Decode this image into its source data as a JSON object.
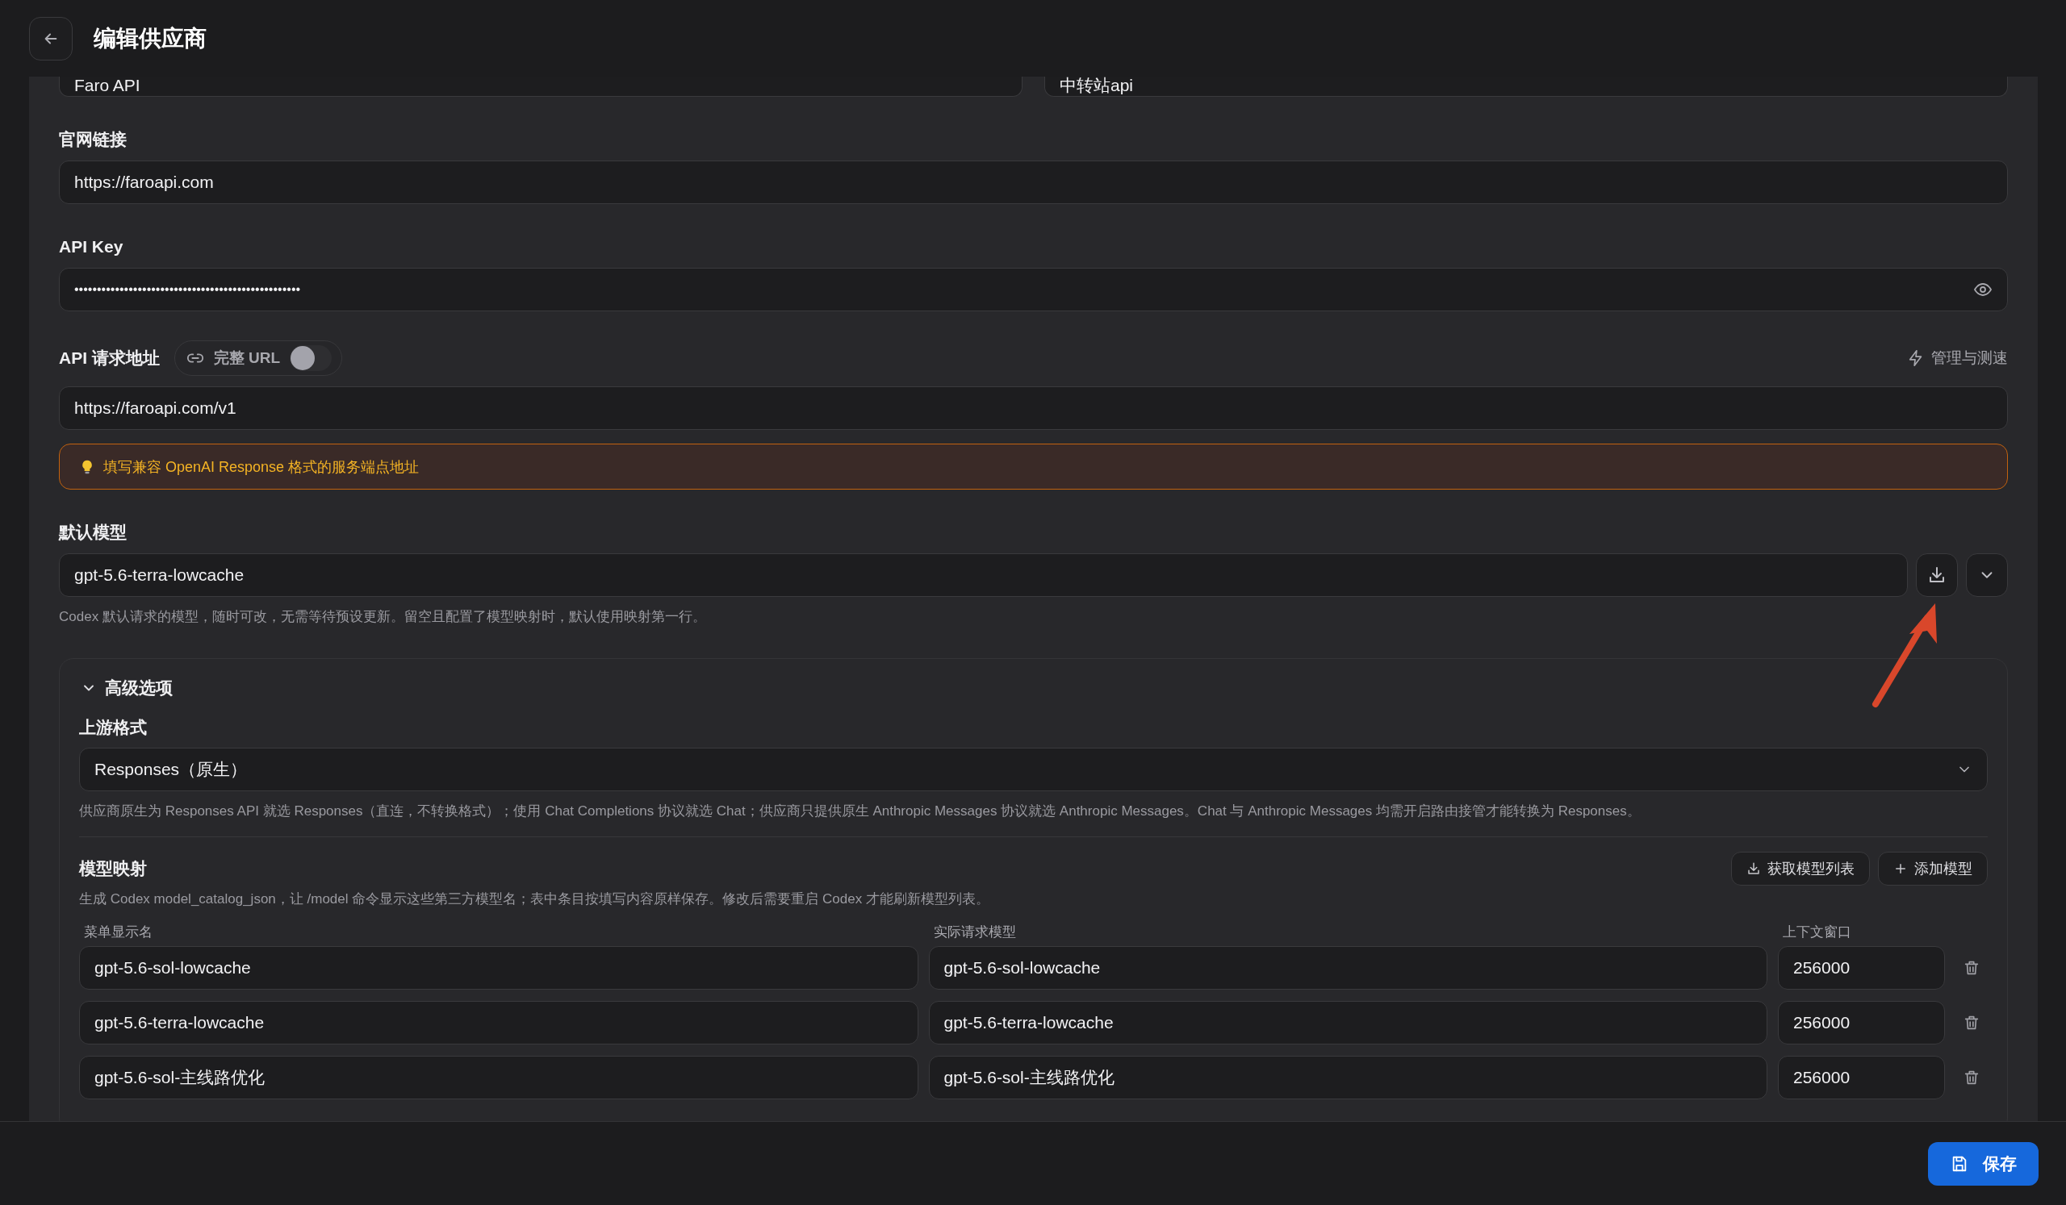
{
  "header": {
    "title": "编辑供应商"
  },
  "basic_fields": [
    {
      "value": "Faro API"
    },
    {
      "value": "中转站api"
    }
  ],
  "website": {
    "label": "官网链接",
    "value": "https://faroapi.com"
  },
  "api_key": {
    "label": "API Key",
    "value": "••••••••••••••••••••••••••••••••••••••••••••••••••"
  },
  "endpoint": {
    "label": "API 请求地址",
    "full_url_toggle": {
      "label": "完整 URL",
      "on": false
    },
    "manage_link": "管理与测速",
    "value": "https://faroapi.com/v1",
    "notice": "填写兼容 OpenAI Response 格式的服务端点地址"
  },
  "default_model": {
    "label": "默认模型",
    "value": "gpt-5.6-terra-lowcache",
    "hint": "Codex 默认请求的模型，随时可改，无需等待预设更新。留空且配置了模型映射时，默认使用映射第一行。"
  },
  "advanced": {
    "title": "高级选项",
    "expanded": true,
    "upstream_format": {
      "label": "上游格式",
      "value": "Responses（原生）",
      "hint": "供应商原生为 Responses API 就选 Responses（直连，不转换格式）；使用 Chat Completions 协议就选 Chat；供应商只提供原生 Anthropic Messages 协议就选 Anthropic Messages。Chat 与 Anthropic Messages 均需开启路由接管才能转换为 Responses。"
    },
    "model_mapping": {
      "title": "模型映射",
      "buttons": [
        {
          "label": "获取模型列表",
          "kind": "fetch"
        },
        {
          "label": "添加模型",
          "kind": "add"
        }
      ],
      "hint": "生成 Codex model_catalog_json，让 /model 命令显示这些第三方模型名；表中条目按填写内容原样保存。修改后需要重启 Codex 才能刷新模型列表。",
      "columns": [
        "菜单显示名",
        "实际请求模型",
        "上下文窗口"
      ],
      "rows": [
        {
          "display_name": "gpt-5.6-sol-lowcache",
          "request_model": "gpt-5.6-sol-lowcache",
          "context_window": "256000"
        },
        {
          "display_name": "gpt-5.6-terra-lowcache",
          "request_model": "gpt-5.6-terra-lowcache",
          "context_window": "256000"
        },
        {
          "display_name": "gpt-5.6-sol-主线路优化",
          "request_model": "gpt-5.6-sol-主线路优化",
          "context_window": "256000"
        }
      ]
    }
  },
  "footer": {
    "save_button": "保存"
  }
}
